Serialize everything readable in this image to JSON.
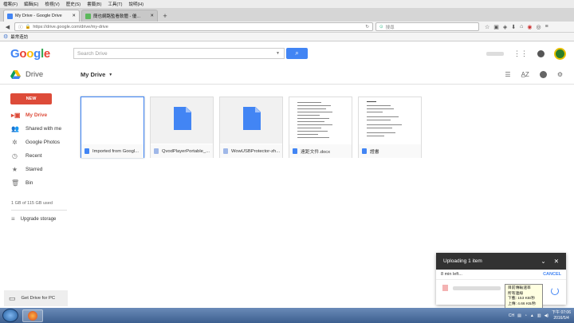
{
  "browser": {
    "menu": [
      "檔案(F)",
      "編輯(E)",
      "檢視(V)",
      "歷史(S)",
      "書籤(B)",
      "工具(T)",
      "說明(H)"
    ],
    "tabs": [
      {
        "label": "My Drive - Google Drive",
        "active": true,
        "favicon_color": "#4285f4"
      },
      {
        "label": "簡也網路監看軟體 - 優...",
        "active": false,
        "favicon_color": "#5cb85c"
      }
    ],
    "new_tab_glyph": "+",
    "url": "https://drive.google.com/drive/my-drive",
    "search_placeholder": "搜尋",
    "bookmark": "最常造訪"
  },
  "header": {
    "logo": "Google",
    "search_placeholder": "Search Drive",
    "product": "Drive",
    "location": "My Drive"
  },
  "sidebar": {
    "new_label": "NEW",
    "items": [
      {
        "label": "My Drive",
        "icon": "drive-folder-icon",
        "selected": true
      },
      {
        "label": "Shared with me",
        "icon": "people-icon",
        "selected": false
      },
      {
        "label": "Google Photos",
        "icon": "photos-icon",
        "selected": false
      },
      {
        "label": "Recent",
        "icon": "clock-icon",
        "selected": false
      },
      {
        "label": "Starred",
        "icon": "star-icon",
        "selected": false
      },
      {
        "label": "Bin",
        "icon": "trash-icon",
        "selected": false
      }
    ],
    "storage": "1 GB of 115 GB used",
    "upgrade": "Upgrade storage",
    "get_drive": "Get Drive for PC"
  },
  "files": [
    {
      "name": "Imported from Googl...",
      "type": "folder",
      "selected": true
    },
    {
      "name": "QvodPlayerPortable_...",
      "type": "file"
    },
    {
      "name": "WowUSBProtector-zh...",
      "type": "file"
    },
    {
      "name": "遠距文件.docx",
      "type": "doc"
    },
    {
      "name": "證書",
      "type": "doc"
    }
  ],
  "upload": {
    "title": "Uploading 1 item",
    "time_left": "8 min left...",
    "cancel": "CANCEL",
    "tooltip": [
      "目前傳輸速率",
      "所有連線",
      "下載: 153 KB/秒",
      "上傳: 4.66 KB/秒"
    ]
  },
  "taskbar": {
    "clock_time": "下午 07:06",
    "clock_date": "2016/5/4",
    "lang": "CH"
  },
  "colors": {
    "accent": "#4285f4",
    "red": "#dd4b39"
  }
}
